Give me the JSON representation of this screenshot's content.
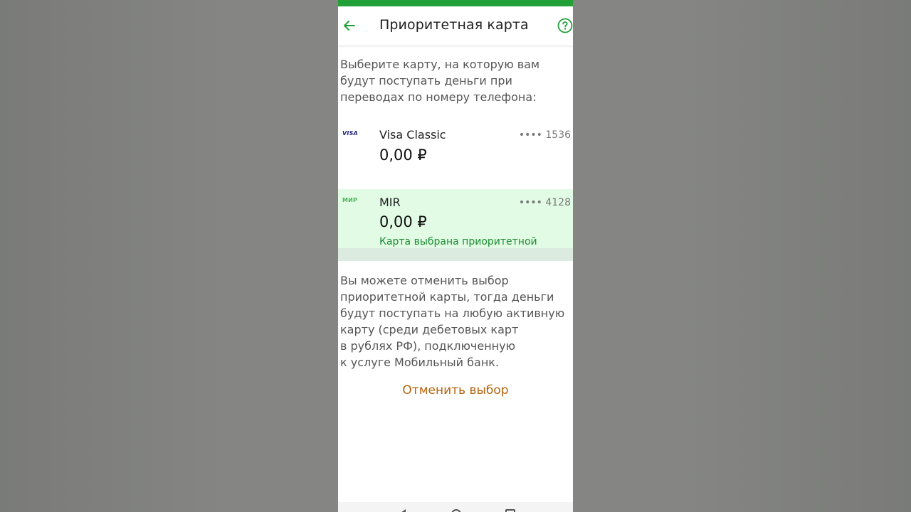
{
  "colors": {
    "brand_green": "#21a038",
    "selected_bg": "#e1fbe4",
    "status_green": "#1c8c33",
    "cancel_orange": "#b4620a"
  },
  "header": {
    "title": "Приоритетная карта",
    "back_icon": "arrow-left-icon",
    "help_icon": "question-circle-icon"
  },
  "intro_text": "Выберите карту, на которую вам будут поступать деньги при переводах по номеру телефона:",
  "cards": [
    {
      "logo": "VISA",
      "name": "Visa Classic",
      "number": "•••• 1536",
      "balance": "0,00 ₽",
      "selected": false
    },
    {
      "logo": "МИР",
      "name": "MIR",
      "number": "•••• 4128",
      "balance": "0,00 ₽",
      "status": "Карта выбрана приоритетной",
      "selected": true
    }
  ],
  "note_text": "Вы можете отменить выбор\nприоритетной карты, тогда деньги\nбудут поступать на любую активную\nкарту (среди дебетовых карт\nв рублях РФ), подключенную\nк услуге Мобильный банк.",
  "cancel_label": "Отменить выбор",
  "navbar": {
    "back_icon": "nav-back-icon",
    "home_icon": "nav-home-icon",
    "recent_icon": "nav-recent-apps-icon"
  }
}
